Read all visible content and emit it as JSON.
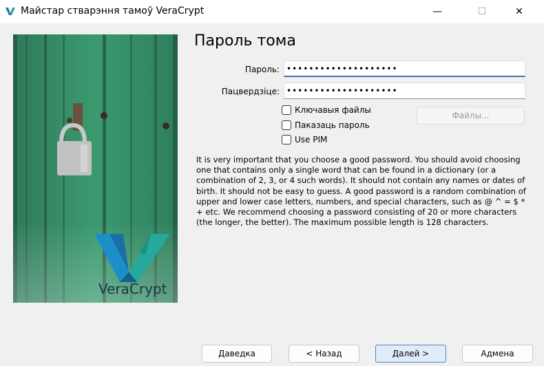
{
  "window": {
    "title": "Майстар стварэння тамоў VeraCrypt",
    "controls": {
      "minimize": "—",
      "maximize": "☐",
      "close": "✕"
    }
  },
  "side_image": {
    "logo_text": "VeraCrypt"
  },
  "page": {
    "heading": "Пароль тома",
    "password_label": "Пароль:",
    "password_value": "••••••••••••••••••••",
    "confirm_label": "Пацвердзіце:",
    "confirm_value": "••••••••••••••••••••",
    "keyfiles_label": "Ключавыя файлы",
    "show_password_label": "Паказаць пароль",
    "use_pim_label": "Use PIM",
    "files_button": "Файлы...",
    "info_text": "It is very important that you choose a good password. You should avoid choosing one that contains only a single word that can be found in a dictionary (or a combination of 2, 3, or 4 such words). It should not contain any names or dates of birth. It should not be easy to guess. A good password is a random combination of upper and lower case letters, numbers, and special characters, such as @ ^ = $ * + etc. We recommend choosing a password consisting of 20 or more characters (the longer, the better). The maximum possible length is 128 characters."
  },
  "footer": {
    "help": "Даведка",
    "back": "< Назад",
    "next": "Далей >",
    "cancel": "Адмена"
  }
}
